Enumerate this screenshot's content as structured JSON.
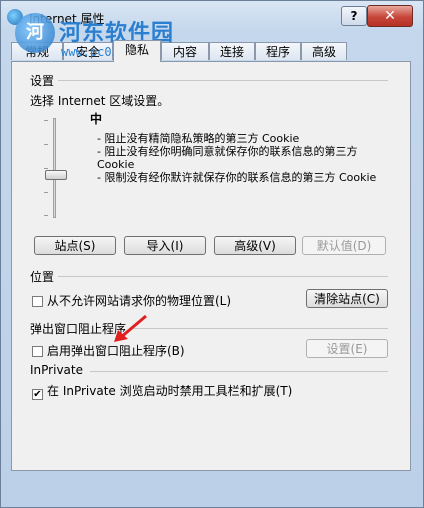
{
  "window": {
    "title": "Internet 属性"
  },
  "watermark": {
    "logo_text": "河",
    "title": "河东软件园",
    "url": "www.pc0359.cn"
  },
  "titlebar": {
    "help_label": "?",
    "close_label": "✕"
  },
  "tabs": [
    {
      "label": "常规"
    },
    {
      "label": "安全"
    },
    {
      "label": "隐私"
    },
    {
      "label": "内容"
    },
    {
      "label": "连接"
    },
    {
      "label": "程序"
    },
    {
      "label": "高级"
    }
  ],
  "settings": {
    "heading": "设置",
    "prompt": "选择 Internet 区域设置。",
    "level": "中",
    "descriptions": [
      "- 阻止没有精简隐私策略的第三方 Cookie",
      "- 阻止没有经你明确同意就保存你的联系信息的第三方 Cookie",
      "- 限制没有经你默许就保存你的联系信息的第三方 Cookie"
    ],
    "slider_level": 0.5
  },
  "buttons": {
    "sites": "站点(S)",
    "import": "导入(I)",
    "advanced": "高级(V)",
    "default": "默认值(D)"
  },
  "location": {
    "heading": "位置",
    "checkbox_label": "从不允许网站请求你的物理位置(L)",
    "clear_button": "清除站点(C)"
  },
  "popup": {
    "heading": "弹出窗口阻止程序",
    "checkbox_label": "启用弹出窗口阻止程序(B)",
    "settings_button": "设置(E)"
  },
  "inprivate": {
    "heading": "InPrivate",
    "checkbox_label": "在 InPrivate 浏览启动时禁用工具栏和扩展(T)",
    "check_mark": "✔"
  },
  "colors": {
    "accent": "#2a7fd0",
    "arrow": "#e02020"
  }
}
